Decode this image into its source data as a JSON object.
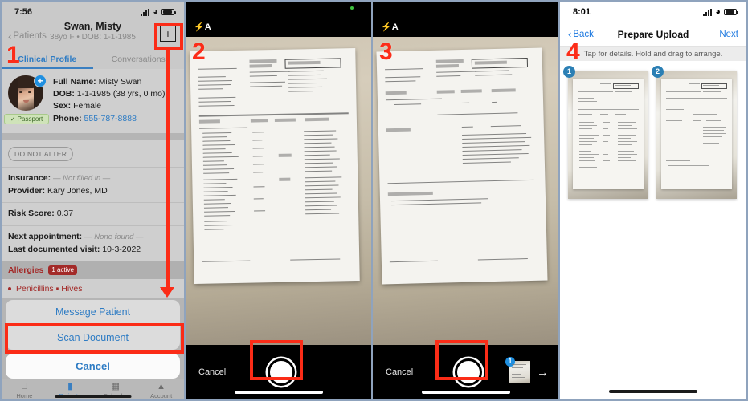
{
  "panel1": {
    "step": "1",
    "status": {
      "time": "7:56",
      "signal_icon": "cellular-bars-icon",
      "wifi_icon": "wifi-icon",
      "battery_icon": "battery-icon"
    },
    "nav": {
      "back_label": "Patients",
      "title": "Swan, Misty",
      "subtitle": "38yo F • DOB: 1-1-1985",
      "add_button": "+"
    },
    "tabs": [
      {
        "label": "Clinical Profile",
        "active": true
      },
      {
        "label": "Conversations",
        "active": false
      }
    ],
    "header_card": {
      "avatar_badge": "+",
      "passport_label": "✓ Passport",
      "full_name_label": "Full Name:",
      "full_name_value": "Misty Swan",
      "dob_label": "DOB:",
      "dob_value": "1-1-1985 (38 yrs, 0 mo)",
      "sex_label": "Sex:",
      "sex_value": "Female",
      "phone_label": "Phone:",
      "phone_value": "555-787-8888"
    },
    "do_not_alter": "DO NOT ALTER",
    "details": {
      "insurance_label": "Insurance:",
      "insurance_value": "— Not filled in —",
      "provider_label": "Provider:",
      "provider_value": "Kary Jones, MD",
      "risk_label": "Risk Score:",
      "risk_value": "0.37",
      "next_appt_label": "Next appointment:",
      "next_appt_value": "— None found —",
      "last_visit_label": "Last documented visit:",
      "last_visit_value": "10-3-2022"
    },
    "allergies": {
      "title": "Allergies",
      "badge": "1 active",
      "items": [
        "Penicillins ▪ Hives"
      ]
    },
    "action_sheet": {
      "items": [
        "Message Patient",
        "Scan Document"
      ],
      "cancel": "Cancel"
    },
    "tabbar": [
      {
        "label": "Home",
        "icon": "home-icon",
        "active": false
      },
      {
        "label": "Patients",
        "icon": "patients-icon",
        "active": true
      },
      {
        "label": "Calendar",
        "icon": "calendar-icon",
        "active": false
      },
      {
        "label": "Account",
        "icon": "account-icon",
        "active": false
      }
    ]
  },
  "panel2": {
    "step": "2",
    "flash_label": "⚡A",
    "recording_dot": "green-recording-dot-icon",
    "cancel_label": "Cancel",
    "shutter_label": "shutter-button"
  },
  "panel3": {
    "step": "3",
    "flash_label": "⚡A",
    "cancel_label": "Cancel",
    "shutter_label": "shutter-button",
    "thumb_badge": "1",
    "next_arrow": "→"
  },
  "panel4": {
    "step": "4",
    "status": {
      "time": "8:01"
    },
    "nav": {
      "back_label": "Back",
      "title": "Prepare Upload",
      "next_label": "Next"
    },
    "hint": "Tap for details. Hold and drag to arrange.",
    "thumbnails": [
      {
        "badge": "1"
      },
      {
        "badge": "2"
      }
    ]
  },
  "colors": {
    "annotation_red": "#fb2c17",
    "ios_blue": "#2e7cc4",
    "allergy_red": "#a32a28",
    "badge_blue": "#2b7fb4"
  }
}
